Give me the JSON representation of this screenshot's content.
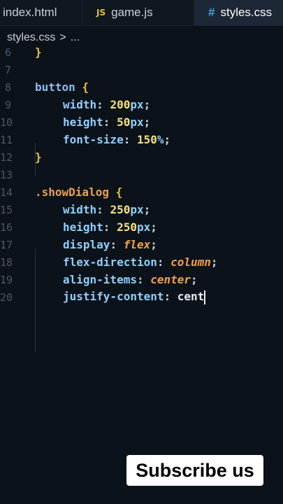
{
  "tabs": [
    {
      "label": "index.html",
      "icon": "html-file-icon"
    },
    {
      "label": "game.js",
      "icon_text": "JS"
    },
    {
      "label": "styles.css",
      "icon_text": "#",
      "active": true
    }
  ],
  "breadcrumb": {
    "file": "styles.css",
    "separator": ">",
    "rest": "..."
  },
  "code": {
    "ln6": "6",
    "ln7": "7",
    "ln8": "8",
    "ln9": "9",
    "ln10": "10",
    "ln11": "11",
    "ln12": "12",
    "ln13": "13",
    "ln14": "14",
    "ln15": "15",
    "ln16": "16",
    "ln17": "17",
    "ln18": "18",
    "ln19": "19",
    "ln20": "20",
    "l6_brace": "}",
    "l8_selector": "button",
    "l8_brace": " {",
    "l9_prop": "width",
    "l9_num": "200",
    "l9_unit": "px",
    "l10_prop": "height",
    "l10_num": "50",
    "l10_unit": "px",
    "l11_prop": "font-size",
    "l11_num": "150",
    "l11_unit": "%",
    "l12_brace": "}",
    "l14_selector": ".showDialog",
    "l14_brace": " {",
    "l15_prop": "width",
    "l15_num": "250",
    "l15_unit": "px",
    "l16_prop": "height",
    "l16_num": "250",
    "l16_unit": "px",
    "l17_prop": "display",
    "l17_val": "flex",
    "l18_prop": "flex-direction",
    "l18_val": "column",
    "l19_prop": "align-items",
    "l19_val": "center",
    "l20_prop": "justify-content",
    "l20_val": "cent"
  },
  "overlay": {
    "subscribe_label": "Subscribe us"
  },
  "colors": {
    "background": "#0b1219",
    "active_tab": "#1c2836",
    "property": "#8fd0ff",
    "number": "#f7e27a",
    "keyword": "#f0a04b"
  }
}
